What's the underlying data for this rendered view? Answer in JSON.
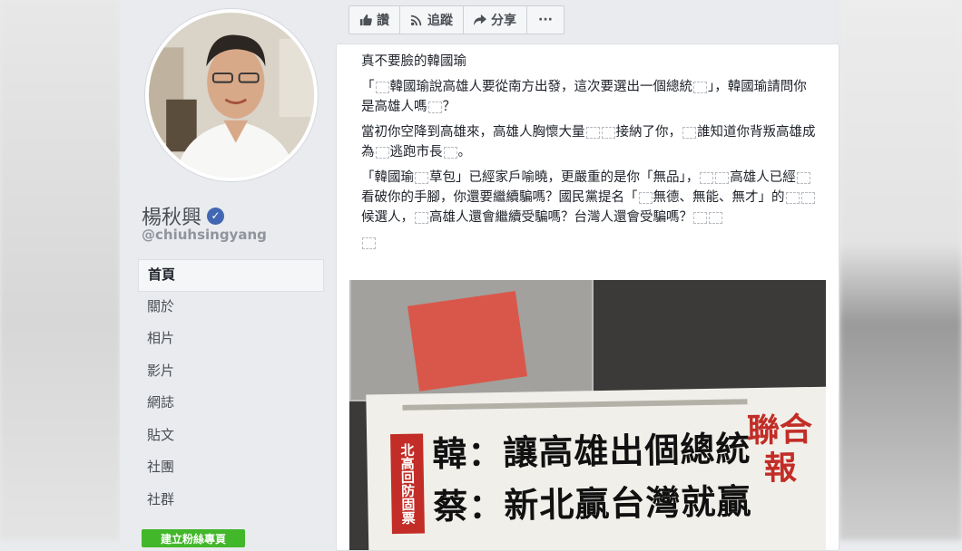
{
  "profile": {
    "name": "楊秋興",
    "handle": "@chiuhsingyang"
  },
  "nav": {
    "items": [
      "首頁",
      "關於",
      "相片",
      "影片",
      "網誌",
      "貼文",
      "社團",
      "社群"
    ]
  },
  "create_page_label": "建立粉絲專頁",
  "actions": {
    "like": "讚",
    "follow": "追蹤",
    "share": "分享",
    "more": "···"
  },
  "post": {
    "title": "真不要臉的韓國瑜",
    "p1_a": "「",
    "p1_b": "韓國瑜說高雄人要從南方出發，這次要選出一個總統",
    "p1_c": "」，韓國瑜請問你是高雄人嗎",
    "p1_d": "？",
    "p2_a": "當初你空降到高雄來，高雄人胸懷大量",
    "p2_b": "接納了你，",
    "p2_c": "誰知道你背叛高雄成為",
    "p2_d": "逃跑市長",
    "p2_e": "。",
    "p3_a": "「韓國瑜",
    "p3_b": "草包」已經家戶喻曉，更嚴重的是你「無品」，",
    "p3_c": "高雄人已經",
    "p3_d": "看破你的手腳，你還要繼續騙嗎？國民黨提名「",
    "p3_e": "無德、無能、無才」的",
    "p3_f": "候選人，",
    "p3_g": "高雄人還會繼續受騙嗎？台灣人還會受騙嗎？"
  },
  "newspaper": {
    "side_label": "北高回防固票",
    "headline_1": "韓：讓高雄出個總統",
    "headline_2": "蔡：新北贏台灣就贏",
    "masthead": "聯合報"
  },
  "colors": {
    "brand_blue": "#4267b2",
    "create_green": "#42b72a",
    "newspaper_red": "#c22d27"
  }
}
